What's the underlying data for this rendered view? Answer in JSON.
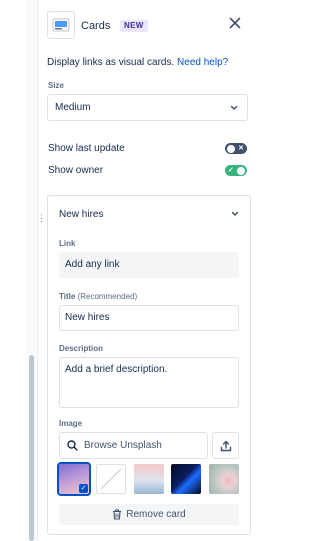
{
  "header": {
    "title": "Cards",
    "badge": "NEW",
    "close_icon": "close-icon",
    "app_icon": "cards-app-icon"
  },
  "description": {
    "text": "Display links as visual cards.",
    "help_link": "Need help?"
  },
  "size": {
    "label": "Size",
    "value": "Medium"
  },
  "toggles": {
    "last_update": {
      "label": "Show last update",
      "on": false
    },
    "owner": {
      "label": "Show owner",
      "on": true
    }
  },
  "card": {
    "title": "New hires",
    "link": {
      "label": "Link",
      "value": "Add any link"
    },
    "title_field": {
      "label": "Title",
      "hint": "(Recommended)",
      "value": "New hires"
    },
    "description_field": {
      "label": "Description",
      "placeholder": "Add a brief description."
    },
    "image": {
      "label": "Image",
      "search_placeholder": "Browse Unsplash",
      "thumbnails": [
        {
          "name": "purple-gradient",
          "selected": true
        },
        {
          "name": "blank",
          "selected": false
        },
        {
          "name": "pastel-sky",
          "selected": false
        },
        {
          "name": "dark-blue-abstract",
          "selected": false
        },
        {
          "name": "pink-flower",
          "selected": false
        }
      ]
    },
    "remove_label": "Remove card"
  },
  "colors": {
    "accent": "#0052cc",
    "toggle_on": "#36b37e",
    "toggle_off": "#42526e",
    "badge_bg": "#eae6ff",
    "badge_text": "#403294"
  }
}
